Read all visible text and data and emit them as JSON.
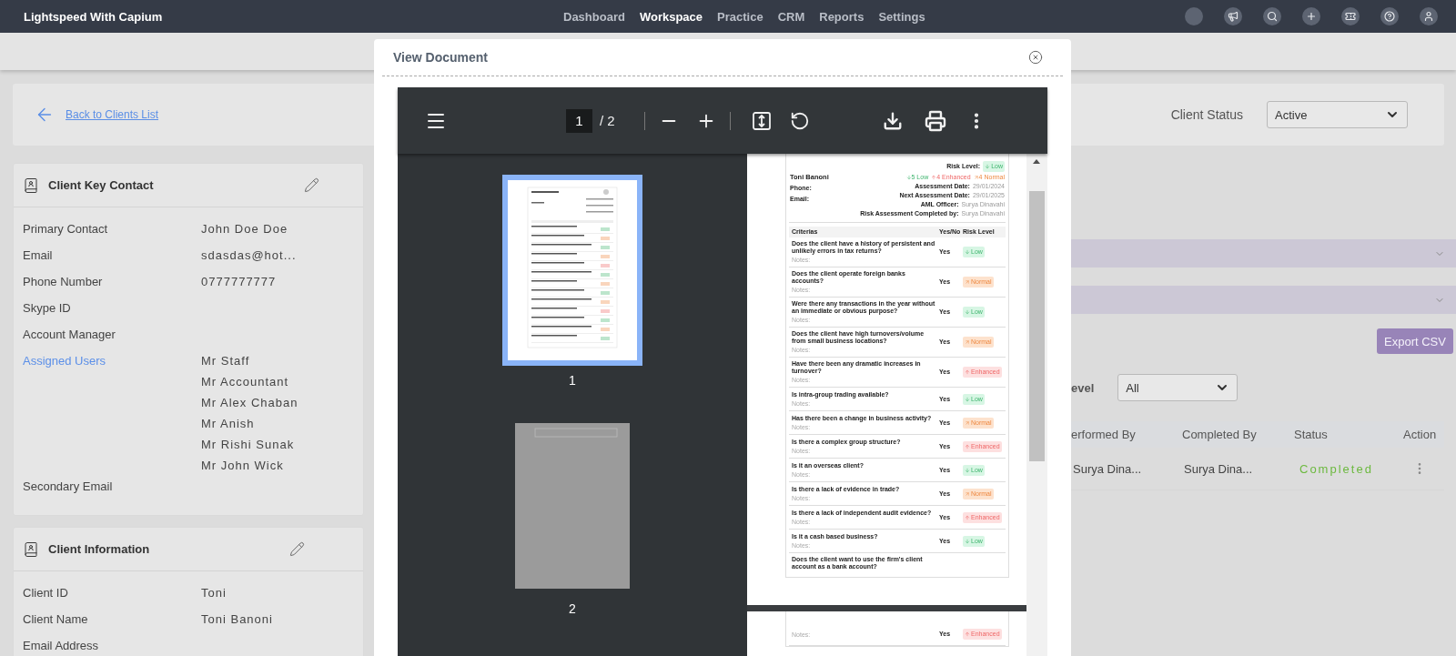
{
  "app": {
    "name": "Lightspeed With Capium"
  },
  "nav": [
    {
      "label": "Dashboard",
      "selected": false
    },
    {
      "label": "Workspace",
      "selected": true
    },
    {
      "label": "Practice",
      "selected": false
    },
    {
      "label": "CRM",
      "selected": false
    },
    {
      "label": "Reports",
      "selected": false
    },
    {
      "label": "Settings",
      "selected": false
    }
  ],
  "back_link": "Back to Clients List",
  "client_status": {
    "label": "Client Status",
    "value": "Active"
  },
  "cards": [
    {
      "title": "Client Key Contact",
      "rows": [
        {
          "kind": "text",
          "label": "Primary Contact",
          "values": [
            "John Doe Doe"
          ]
        },
        {
          "kind": "text",
          "label": "Email",
          "values": [
            "sdasdas@hot..."
          ]
        },
        {
          "kind": "text",
          "label": "Phone Number",
          "values": [
            "0777777777"
          ]
        },
        {
          "kind": "text",
          "label": "Skype ID"
        },
        {
          "kind": "text",
          "label": "Account Manager"
        },
        {
          "kind": "link",
          "label": "Assigned Users",
          "values": [
            "Mr Staff",
            "Mr Accountant",
            "Mr Alex Chaban",
            "Mr Anish",
            "Mr Rishi Sunak",
            "Mr John Wick"
          ]
        },
        {
          "kind": "text",
          "label": "Secondary Email"
        }
      ]
    },
    {
      "title": "Client Information",
      "rows": [
        {
          "kind": "text",
          "label": "Client ID",
          "values": [
            "Toni"
          ]
        },
        {
          "kind": "text",
          "label": "Client Name",
          "values": [
            "Toni Banoni"
          ]
        },
        {
          "kind": "text",
          "label": "Email Address"
        }
      ]
    }
  ],
  "modal": {
    "title": "View Document"
  },
  "viewer": {
    "page": "1",
    "total": "/ 2"
  },
  "thumbnails": [
    {
      "label": "1",
      "selected": true
    },
    {
      "label": "2",
      "selected": false
    }
  ],
  "document": {
    "risk_level_label": "Risk Level:",
    "risk_level": {
      "kind": "low",
      "label": "Low"
    },
    "client_name": "Toni Banoni",
    "legend": [
      {
        "kind": "low",
        "label": "5 Low"
      },
      {
        "kind": "enhanced",
        "label": "4 Enhanced"
      },
      {
        "kind": "normal",
        "label": "4 Normal"
      }
    ],
    "contact_labels": [
      "Phone:",
      "Email:"
    ],
    "facts": [
      {
        "label": "Assessment Date:",
        "value": "29/01/2024"
      },
      {
        "label": "Next Assessment Date:",
        "value": "29/01/2025"
      },
      {
        "label": "AML Officer:",
        "value": "Surya Dinavahi"
      },
      {
        "label": "Risk Assessment Completed by:",
        "value": "Surya Dinavahi"
      }
    ],
    "columns": [
      "Criterias",
      "Yes/No",
      "Risk Level"
    ],
    "rows": [
      {
        "question": "Does the client have a history of persistent and unlikely errors in tax returns?",
        "notes": "Notes:",
        "answer": "Yes",
        "risk": {
          "kind": "low",
          "label": "Low"
        }
      },
      {
        "question": "Does the client operate foreign banks accounts?",
        "notes": "Notes:",
        "answer": "Yes",
        "risk": {
          "kind": "normal",
          "label": "Normal"
        }
      },
      {
        "question": "Were there any transactions in the year without an immediate or obvious purpose?",
        "notes": "Notes:",
        "answer": "Yes",
        "risk": {
          "kind": "low",
          "label": "Low"
        }
      },
      {
        "question": "Does the client have high turnovers/volume from small business locations?",
        "notes": "Notes:",
        "answer": "Yes",
        "risk": {
          "kind": "normal",
          "label": "Normal"
        }
      },
      {
        "question": "Have there been any dramatic increases in turnover?",
        "notes": "Notes:",
        "answer": "Yes",
        "risk": {
          "kind": "enhanced",
          "label": "Enhanced"
        }
      },
      {
        "question": "Is intra-group trading available?",
        "notes": "Notes:",
        "answer": "Yes",
        "risk": {
          "kind": "low",
          "label": "Low"
        }
      },
      {
        "question": "Has there been a change in business activity?",
        "notes": "Notes:",
        "answer": "Yes",
        "risk": {
          "kind": "normal",
          "label": "Normal"
        }
      },
      {
        "question": "Is there a complex group structure?",
        "notes": "Notes:",
        "answer": "Yes",
        "risk": {
          "kind": "enhanced",
          "label": "Enhanced"
        }
      },
      {
        "question": "Is it an overseas client?",
        "notes": "Notes:",
        "answer": "Yes",
        "risk": {
          "kind": "low",
          "label": "Low"
        }
      },
      {
        "question": "Is there a lack of evidence in trade?",
        "notes": "Notes:",
        "answer": "Yes",
        "risk": {
          "kind": "normal",
          "label": "Normal"
        }
      },
      {
        "question": "Is there a lack of independent audit evidence?",
        "notes": "Notes:",
        "answer": "Yes",
        "risk": {
          "kind": "enhanced",
          "label": "Enhanced"
        }
      },
      {
        "question": "Is it a cash based business?",
        "notes": "Notes:",
        "answer": "Yes",
        "risk": {
          "kind": "low",
          "label": "Low"
        }
      }
    ],
    "last_question": "Does the client want to use the firm's client account as a bank account?",
    "page2_row": {
      "notes": "Notes:",
      "answer": "Yes",
      "risk": {
        "kind": "enhanced",
        "label": "Enhanced"
      }
    }
  },
  "export_button": "Export CSV",
  "filter": {
    "label": "evel",
    "value": "All"
  },
  "table": {
    "columns": [
      "erformed By",
      "Completed By",
      "Status",
      "Action"
    ],
    "rows": [
      {
        "performed_by": "Surya Dina...",
        "completed_by": "Surya Dina...",
        "status": "Completed"
      }
    ]
  }
}
